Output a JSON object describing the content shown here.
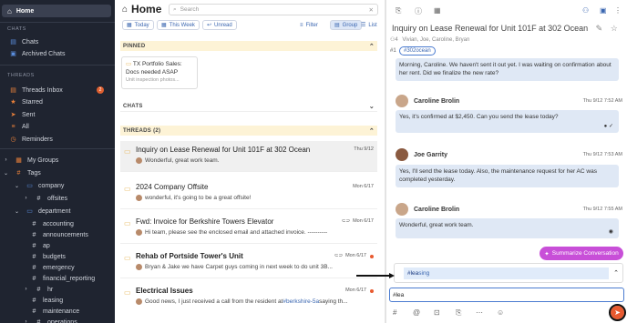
{
  "sidebar": {
    "home_label": "Home",
    "chats_header": "CHATS",
    "chats_items": [
      {
        "label": "Chats"
      },
      {
        "label": "Archived Chats"
      }
    ],
    "threads_header": "THREADS",
    "threads_items": [
      {
        "label": "Threads Inbox",
        "badge": "2"
      },
      {
        "label": "Starred"
      },
      {
        "label": "Sent"
      },
      {
        "label": "All"
      },
      {
        "label": "Reminders"
      }
    ],
    "my_groups": "My Groups",
    "tags": "Tags",
    "tag_tree": [
      {
        "label": "company",
        "level": 1
      },
      {
        "label": "offsites",
        "level": 2
      },
      {
        "label": "department",
        "level": 1
      },
      {
        "label": "accounting",
        "level": 2
      },
      {
        "label": "announcements",
        "level": 2
      },
      {
        "label": "ap",
        "level": 2
      },
      {
        "label": "budgets",
        "level": 2
      },
      {
        "label": "emergency",
        "level": 2
      },
      {
        "label": "financial_reporting",
        "level": 2
      },
      {
        "label": "hr",
        "level": 2
      },
      {
        "label": "leasing",
        "level": 2
      },
      {
        "label": "maintenance",
        "level": 2
      },
      {
        "label": "operations",
        "level": 2
      }
    ]
  },
  "middle": {
    "title": "Home",
    "search_placeholder": "Search",
    "chips": {
      "today": "Today",
      "this_week": "This Week",
      "unread": "Unread",
      "filter": "Filter",
      "group": "Group",
      "list": "List"
    },
    "pinned_header": "PINNED",
    "pinned_card": {
      "line1": "TX Portfolio Sales:",
      "line2": "Docs needed ASAP",
      "line3": "Unit inspection photos..."
    },
    "chats_header": "CHATS",
    "threads_header": "THREADS (2)",
    "threads": [
      {
        "title": "Inquiry on Lease Renewal for Unit 101F at 302 Ocean",
        "date": "Thu 9/12",
        "preview": "Wonderful, great work team."
      },
      {
        "title": "2024 Company Offsite",
        "date": "Mon 6/17",
        "preview": "wonderful, it's going to be a great offsite!"
      },
      {
        "title": "Fwd: Invoice for Berkshire Towers Elevator",
        "date": "Mon 6/17",
        "preview": "Hi team, please see the enclosed email and attached invoice. ----------"
      },
      {
        "title": "Rehab of Portside Tower's Unit",
        "date": "Mon 6/17",
        "preview": "Bryan & Jake we have Carpet guys coming in next week to do unit 3B..."
      },
      {
        "title": "Electrical Issues",
        "date": "Mon 6/17",
        "preview_prefix": "Good news, I just received a call from the resident at ",
        "preview_link": "#berkshire-5a",
        "preview_suffix": " saying th..."
      }
    ]
  },
  "right": {
    "title": "Inquiry on Lease Renewal for Unit 101F at 302 Ocean",
    "participants_count": "4",
    "participants": "Vivian, Joe, Caroline, Bryan",
    "tag_count": "1",
    "tag": "#302ocean",
    "messages": [
      {
        "sender": "",
        "time": "",
        "text": "Morning, Caroline. We haven't sent it out yet. I was waiting on confirmation about her rent. Did we finalize the new rate?"
      },
      {
        "sender": "Caroline Brolin",
        "time": "Thu 9/12 7:52 AM",
        "text": "Yes, it's confirmed at $2,450. Can you send the lease today?"
      },
      {
        "sender": "Joe Garrity",
        "time": "Thu 9/12 7:53 AM",
        "text": "Yes, I'll send the lease today. Also, the maintenance request for her AC was completed yesterday."
      },
      {
        "sender": "Caroline Brolin",
        "time": "Thu 9/12 7:55 AM",
        "text": "Wonderful, great work team."
      }
    ],
    "summarize_label": "Summarize Conversation",
    "suggestion": "#leasing",
    "suggestion_match": "#lea",
    "suggestion_rest": "sing",
    "composer_value": "#lea"
  }
}
